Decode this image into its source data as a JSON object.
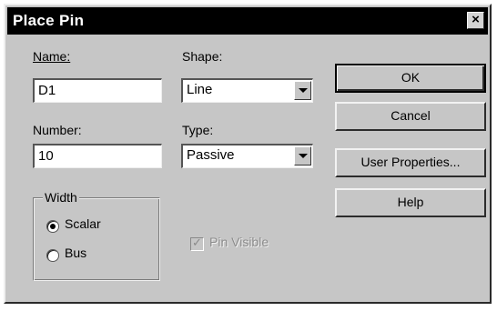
{
  "window": {
    "title": "Place Pin",
    "close_glyph": "×"
  },
  "name": {
    "label": "Name:",
    "value": "D1"
  },
  "number": {
    "label": "Number:",
    "value": "10"
  },
  "shape": {
    "label": "Shape:",
    "value": "Line"
  },
  "type": {
    "label": "Type:",
    "value": "Passive"
  },
  "width_group": {
    "label": "Width",
    "options": [
      {
        "label": "Scalar",
        "selected": true
      },
      {
        "label": "Bus",
        "selected": false
      }
    ]
  },
  "pin_visible": {
    "label": "Pin Visible",
    "checked": true,
    "enabled": false
  },
  "buttons": {
    "ok": "OK",
    "cancel": "Cancel",
    "user_properties": "User Properties...",
    "help": "Help"
  }
}
